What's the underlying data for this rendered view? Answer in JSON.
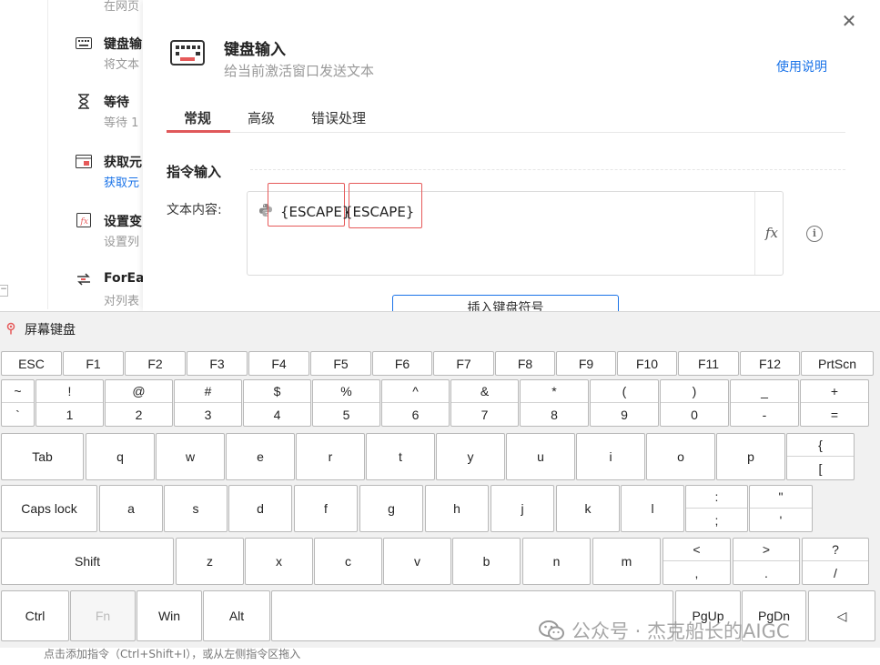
{
  "left_list": {
    "top_partial": "在网页",
    "items": [
      {
        "title": "键盘输",
        "desc": "将文本",
        "desc_color": "gray",
        "icon": "keyboard-icon"
      },
      {
        "title": "等待",
        "desc": "等待 1",
        "desc_color": "gray",
        "icon": "hourglass-icon"
      },
      {
        "title": "获取元",
        "desc": "获取元",
        "desc_color": "blue",
        "icon": "get-element-icon"
      },
      {
        "title": "设置变",
        "desc": "设置列",
        "desc_color": "gray",
        "icon": "set-variable-icon"
      },
      {
        "title": "ForEa",
        "desc": "对列表",
        "desc_color": "gray",
        "icon": "foreach-icon"
      }
    ],
    "collapse_symbol": "−"
  },
  "dialog": {
    "close_symbol": "✕",
    "title": "键盘输入",
    "subtitle": "给当前激活窗口发送文本",
    "help_link": "使用说明",
    "tabs": [
      "常规",
      "高级",
      "错误处理"
    ],
    "active_tab": 0,
    "section_title": "指令输入",
    "field_label": "文本内容:",
    "tokens": [
      "{ESCAPE}",
      "{ESCAPE}"
    ],
    "fx_label": "fx",
    "info_symbol": "i",
    "insert_button": "插入键盘符号"
  },
  "osk": {
    "title": "屏幕键盘",
    "fn_row": [
      "ESC",
      "F1",
      "F2",
      "F3",
      "F4",
      "F5",
      "F6",
      "F7",
      "F8",
      "F9",
      "F10",
      "F11",
      "F12",
      "PrtScn"
    ],
    "number_row": [
      {
        "up": "~",
        "dn": "`"
      },
      {
        "up": "!",
        "dn": "1"
      },
      {
        "up": "@",
        "dn": "2"
      },
      {
        "up": "#",
        "dn": "3"
      },
      {
        "up": "$",
        "dn": "4"
      },
      {
        "up": "%",
        "dn": "5"
      },
      {
        "up": "^",
        "dn": "6"
      },
      {
        "up": "&",
        "dn": "7"
      },
      {
        "up": "*",
        "dn": "8"
      },
      {
        "up": "(",
        "dn": "9"
      },
      {
        "up": ")",
        "dn": "0"
      },
      {
        "up": "_",
        "dn": "-"
      },
      {
        "up": "+",
        "dn": "="
      }
    ],
    "tab_row": {
      "tab": "Tab",
      "letters": [
        "q",
        "w",
        "e",
        "r",
        "t",
        "y",
        "u",
        "i",
        "o",
        "p"
      ],
      "bracket": {
        "up": "{",
        "dn": "["
      }
    },
    "caps_row": {
      "caps": "Caps lock",
      "letters": [
        "a",
        "s",
        "d",
        "f",
        "g",
        "h",
        "j",
        "k",
        "l"
      ],
      "colon": {
        "up": ":",
        "dn": ";"
      },
      "quote": {
        "up": "\"",
        "dn": "'"
      }
    },
    "shift_row": {
      "shift": "Shift",
      "letters": [
        "z",
        "x",
        "c",
        "v",
        "b",
        "n",
        "m"
      ],
      "comma": {
        "up": "<",
        "dn": ","
      },
      "period": {
        "up": ">",
        "dn": "."
      },
      "slash": {
        "up": "?",
        "dn": "/"
      }
    },
    "bottom_row": {
      "ctrl": "Ctrl",
      "fn": "Fn",
      "win": "Win",
      "alt": "Alt",
      "space": "",
      "pgup": "PgUp",
      "pgdn": "PgDn",
      "left": "◁"
    }
  },
  "bottom_text": "点击添加指令（Ctrl+Shift+I），或从左侧指令区拖入",
  "watermark": "公众号 · 杰克船长的AIGC",
  "colors": {
    "accent_blue": "#1a73e8",
    "highlight_red": "#e65a5a",
    "tab_red": "#e0585a"
  }
}
